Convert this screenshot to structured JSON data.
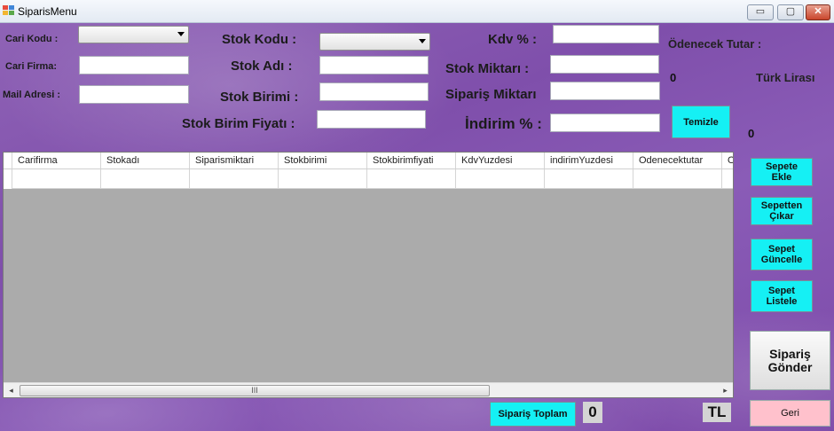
{
  "window": {
    "title": "SiparisMenu",
    "min": "▭",
    "max": "▢",
    "close": "✕"
  },
  "labels": {
    "cari_kodu": "Cari Kodu :",
    "cari_firma": "Cari Firma:",
    "mail_adresi": "Mail Adresi :",
    "stok_kodu": "Stok Kodu :",
    "stok_adi": "Stok Adı :",
    "stok_birimi": "Stok Birimi :",
    "stok_birim_fiyati": "Stok Birim Fiyatı :",
    "kdv": "Kdv % :",
    "stok_miktari": "Stok Miktarı :",
    "siparis_miktari": "Sipariş Miktarı",
    "indirim": "İndirim % :",
    "odenecek_tutar": "Ödenecek Tutar :",
    "turk_lirasi": "Türk Lirası"
  },
  "fields": {
    "cari_kodu": "",
    "cari_firma": "",
    "mail_adresi": "",
    "stok_kodu": "",
    "stok_adi": "",
    "stok_birimi": "",
    "stok_birim_fiyati": "",
    "kdv": "",
    "stok_miktari": "",
    "siparis_miktari": "",
    "indirim": ""
  },
  "values": {
    "odenecek_tutar": "0",
    "indirim_tutar": "0",
    "siparis_toplam": "0",
    "currency": "TL"
  },
  "buttons": {
    "temizle": "Temizle",
    "sepete_ekle": "Sepete\nEkle",
    "sepetten_cikar": "Sepetten\nÇıkar",
    "sepet_guncelle": "Sepet\nGüncelle",
    "sepet_listele": "Sepet\nListele",
    "siparis_gonder": "Sipariş\nGönder",
    "siparis_toplam": "Sipariş Toplam",
    "geri": "Geri"
  },
  "grid": {
    "columns": [
      "Carifirma",
      "Stokadı",
      "Siparismiktari",
      "Stokbirimi",
      "Stokbirimfiyati",
      "KdvYuzdesi",
      "indirimYuzdesi",
      "Odenecektutar",
      "O"
    ],
    "scroll_left": "◂",
    "scroll_right": "▸",
    "thumb_grip": "III"
  },
  "colors": {
    "accent_button": "#15f0f4",
    "back_button": "#ffc1cc",
    "background": "#8a5cb7"
  }
}
